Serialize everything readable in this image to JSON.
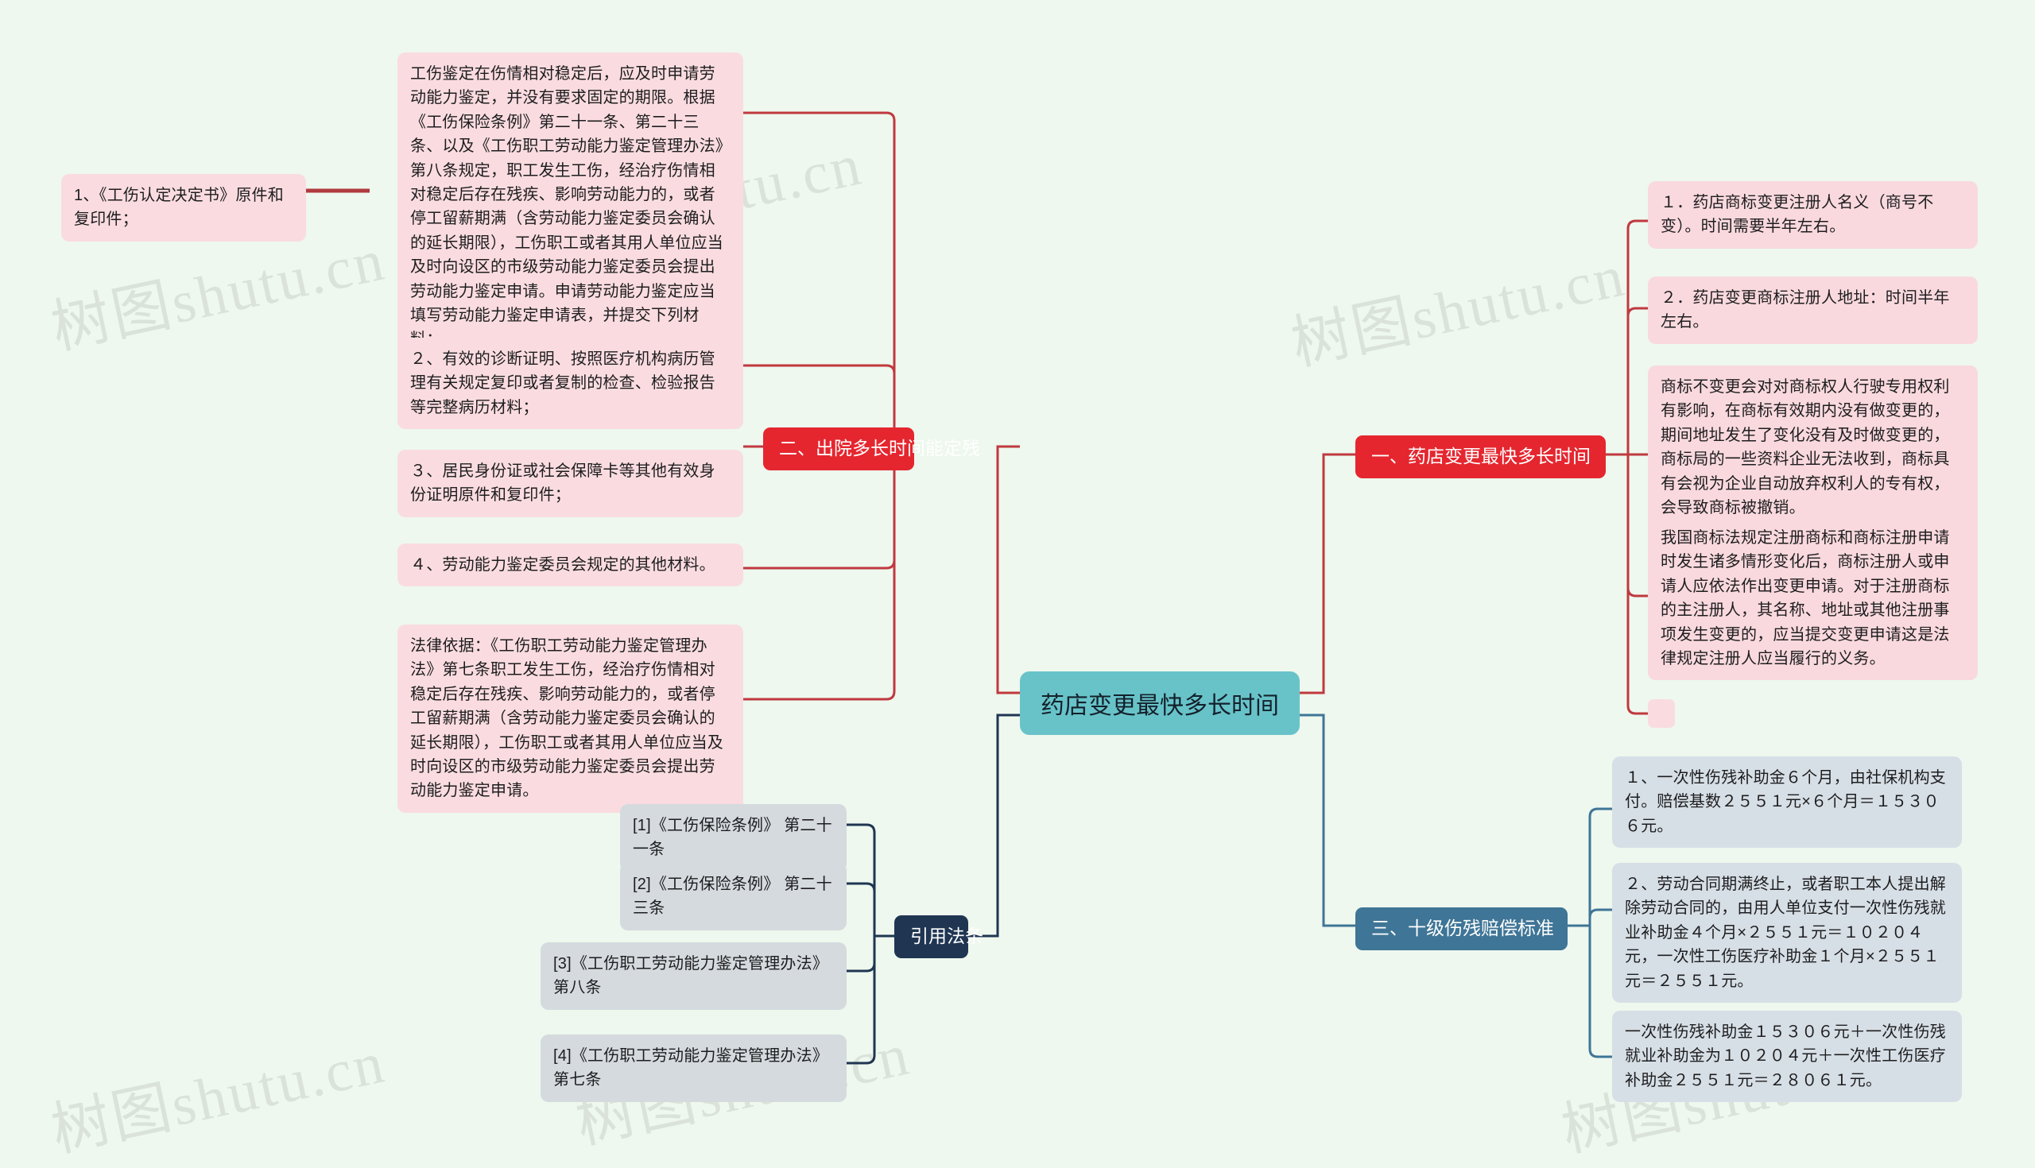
{
  "canvas": {
    "background": "#eef8ee",
    "watermark_text": "树图shutu.cn"
  },
  "root": {
    "label": "药店变更最快多长时间",
    "color": "#68c3c9"
  },
  "branches": [
    {
      "id": "branch-chuyuan",
      "label": "二、出院多长时间能定残",
      "color": "#e5262f",
      "side": "left",
      "items": [
        {
          "id": "item-gongshang-jianding",
          "text": "工伤鉴定在伤情相对稳定后，应及时申请劳动能力鉴定，并没有要求固定的期限。根据《工伤保险条例》第二十一条、第二十三条、以及《工伤职工劳动能力鉴定管理办法》第八条规定，职工发生工伤，经治疗伤情相对稳定后存在残疾、影响劳动能力的，或者停工留薪期满（含劳动能力鉴定委员会确认的延长期限），工伤职工或者其用人单位应当及时向设区的市级劳动能力鉴定委员会提出劳动能力鉴定申请。申请劳动能力鉴定应当填写劳动能力鉴定申请表，并提交下列材料："
        },
        {
          "id": "item-material-2",
          "text": "２、有效的诊断证明、按照医疗机构病历管理有关规定复印或者复制的检查、检验报告等完整病历材料；"
        },
        {
          "id": "item-material-3",
          "text": "３、居民身份证或社会保障卡等其他有效身份证明原件和复印件；"
        },
        {
          "id": "item-material-4",
          "text": "４、劳动能力鉴定委员会规定的其他材料。"
        },
        {
          "id": "item-legal-basis",
          "text": "法律依据：《工伤职工劳动能力鉴定管理办法》第七条职工发生工伤，经治疗伤情相对稳定后存在残疾、影响劳动能力的，或者停工留薪期满（含劳动能力鉴定委员会确认的延长期限），工伤职工或者其用人单位应当及时向设区的市级劳动能力鉴定委员会提出劳动能力鉴定申请。"
        }
      ],
      "sub_item": {
        "id": "item-material-1",
        "text": "1、《工伤认定决定书》原件和复印件；"
      }
    },
    {
      "id": "branch-yinyong-fatiao",
      "label": "引用法条",
      "color": "#1f3552",
      "side": "left",
      "items": [
        {
          "id": "law-1",
          "text": "[1]《工伤保险条例》 第二十一条"
        },
        {
          "id": "law-2",
          "text": "[2]《工伤保险条例》 第二十三条"
        },
        {
          "id": "law-3",
          "text": "[3]《工伤职工劳动能力鉴定管理办法》 第八条"
        },
        {
          "id": "law-4",
          "text": "[4]《工伤职工劳动能力鉴定管理办法》 第七条"
        }
      ]
    },
    {
      "id": "branch-yaodian-biangeng",
      "label": "一、药店变更最快多长时间",
      "color": "#e5262f",
      "side": "right",
      "items": [
        {
          "id": "yd-1",
          "text": "１．药店商标变更注册人名义（商号不变）。时间需要半年左右。"
        },
        {
          "id": "yd-2",
          "text": "２．药店变更商标注册人地址：时间半年左右。"
        },
        {
          "id": "yd-3",
          "text": "商标不变更会对对商标权人行驶专用权利有影响，在商标有效期内没有做变更的，期间地址发生了变化没有及时做变更的，商标局的一些资料企业无法收到，商标具有会视为企业自动放弃权利人的专有权，会导致商标被撤销。"
        },
        {
          "id": "yd-4",
          "text": "我国商标法规定注册商标和商标注册申请时发生诸多情形变化后，商标注册人或申请人应依法作出变更申请。对于注册商标的主注册人，其名称、地址或其他注册事项发生变更的，应当提交变更申请这是法律规定注册人应当履行的义务。"
        },
        {
          "id": "yd-5",
          "text": ""
        }
      ]
    },
    {
      "id": "branch-shiji-peichang",
      "label": "三、十级伤残赔偿标准",
      "color": "#3f7596",
      "side": "right",
      "items": [
        {
          "id": "pc-1",
          "text": "１、一次性伤残补助金６个月，由社保机构支付。赔偿基数２５５１元×６个月＝１５３０６元。"
        },
        {
          "id": "pc-2",
          "text": "２、劳动合同期满终止，或者职工本人提出解除劳动合同的，由用人单位支付一次性伤残就业补助金４个月×２５５１元＝１０２０４元，一次性工伤医疗补助金１个月×２５５１元＝２５５１元。"
        },
        {
          "id": "pc-3",
          "text": "一次性伤残补助金１５３０６元＋一次性伤残就业补助金为１０２０４元＋一次性工伤医疗补助金２５５１元＝２８０６１元。"
        }
      ]
    }
  ]
}
